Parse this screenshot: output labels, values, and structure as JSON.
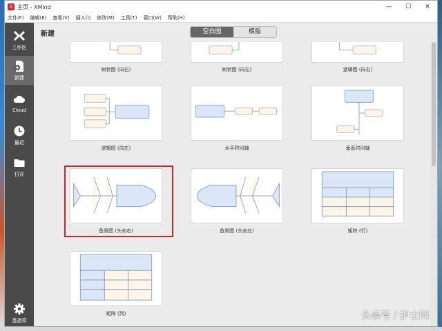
{
  "window": {
    "title": "主页 - XMind",
    "minimize": "—",
    "maximize": "☐",
    "close": "✕"
  },
  "menu": [
    "文件(F)",
    "编辑(E)",
    "查看(V)",
    "插入(I)",
    "修改(M)",
    "工具(T)",
    "窗口(W)",
    "帮助(H)"
  ],
  "sidebar": {
    "items": [
      {
        "label": "工作区",
        "icon": "xmind-logo-icon"
      },
      {
        "label": "新建",
        "icon": "new-document-icon"
      },
      {
        "label": "Cloud",
        "icon": "cloud-icon"
      },
      {
        "label": "最近",
        "icon": "clock-icon"
      },
      {
        "label": "打开",
        "icon": "folder-icon"
      },
      {
        "label": "首选项",
        "icon": "gear-icon"
      }
    ]
  },
  "header": {
    "title": "新建",
    "tabs": [
      "空白图",
      "模版"
    ]
  },
  "templates": [
    {
      "caption": "树状图 (向右)"
    },
    {
      "caption": "树状图 (向左)"
    },
    {
      "caption": "逻辑图 (向右)"
    },
    {
      "caption": "逻辑图 (向左)"
    },
    {
      "caption": "水平时间轴"
    },
    {
      "caption": "垂直时间轴"
    },
    {
      "caption": "鱼骨图 (头向右)"
    },
    {
      "caption": "鱼骨图 (头向左)"
    },
    {
      "caption": "矩阵 (行)"
    },
    {
      "caption": "矩阵 (列)"
    }
  ],
  "watermark": "头条号 / 护士网",
  "colors": {
    "accent_blue": "#dbe6f7",
    "cream": "#fdf6e8",
    "highlight_red": "#c8282a"
  }
}
